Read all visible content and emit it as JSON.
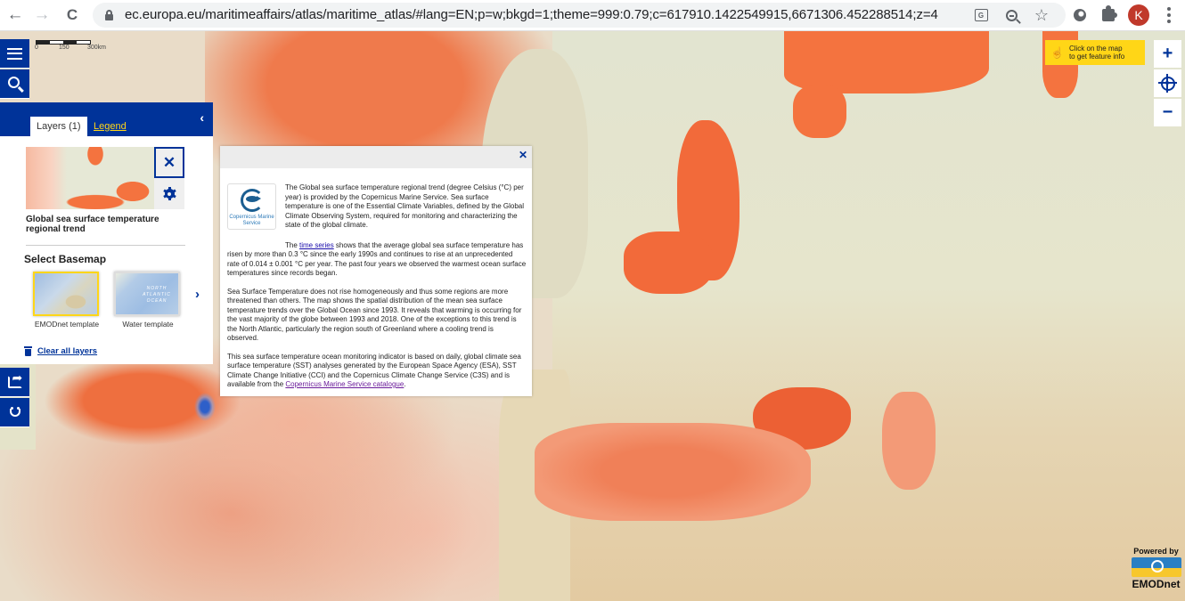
{
  "browser": {
    "url": "ec.europa.eu/maritimeaffairs/atlas/maritime_atlas/#lang=EN;p=w;bkgd=1;theme=999:0.79;c=617910.1422549915,6671306.452288514;z=4",
    "back_icon": "←",
    "forward_icon": "→",
    "reload_icon": "C",
    "translate_label": "G",
    "star_icon": "☆",
    "profile_initial": "K"
  },
  "map": {
    "scale": {
      "labels": [
        "0",
        "150",
        "300km"
      ]
    },
    "feature_tip": {
      "line1": "Click on the map",
      "line2": "to get feature info",
      "icon": "☝"
    },
    "zoom_in_label": "+",
    "zoom_out_label": "−",
    "powered_by": {
      "label": "Powered by",
      "brand": "EMODnet"
    },
    "colors": {
      "warming": "#f4733f",
      "cooling": "#2e5fc9",
      "brand_blue": "#003399",
      "highlight_yellow": "#ffd617"
    }
  },
  "layers_panel": {
    "tabs": [
      {
        "label": "Layers (1)",
        "active": true
      },
      {
        "label": "Legend",
        "active": false
      }
    ],
    "collapse_icon": "‹",
    "layer": {
      "title": "Global sea surface temperature regional trend",
      "remove_icon": "✕"
    },
    "basemap": {
      "title": "Select Basemap",
      "options": [
        {
          "label": "EMODnet template",
          "selected": true
        },
        {
          "label": "Water template",
          "selected": false,
          "thumb_text": "NORTH ATLANTIC OCEAN"
        }
      ],
      "next_icon": "›"
    },
    "clear_all_label": "Clear all layers"
  },
  "popup": {
    "close_icon": "✕",
    "logo_text": "Copernicus Marine Service",
    "p1": "The Global sea surface temperature regional trend (degree Celsius (°C) per year) is provided by the Copernicus Marine Service. Sea surface temperature is one of the Essential Climate Variables, defined by the Global Climate Observing System, required for monitoring and characterizing the state of the global climate.",
    "p2_prefix": "The ",
    "p2_link": "time series",
    "p2_rest": " shows that the average global sea surface temperature has risen by more than 0.3 °C since the early 1990s and continues to rise at an unprecedented rate of 0.014 ± 0.001 °C per year. The past four years we observed the warmest ocean surface temperatures since records began.",
    "p3": "Sea Surface Temperature does not rise homogeneously and thus some regions are more threatened than others. The map shows the spatial distribution of the mean sea surface temperature trends over the Global Ocean since 1993. It reveals that warming is occurring for the vast majority of the globe between 1993 and 2018. One of the exceptions to this trend is the North Atlantic, particularly the region south of Greenland where a cooling trend is observed.",
    "p4_prefix": "This sea surface temperature ocean monitoring indicator is based on daily, global climate sea surface temperature (SST) analyses generated by the European Space Agency (ESA), SST Climate Change Initiative (CCI) and the Copernicus Climate Change Service (C3S) and is available from the ",
    "p4_link": "Copernicus Marine Service catalogue",
    "p4_suffix": "."
  }
}
